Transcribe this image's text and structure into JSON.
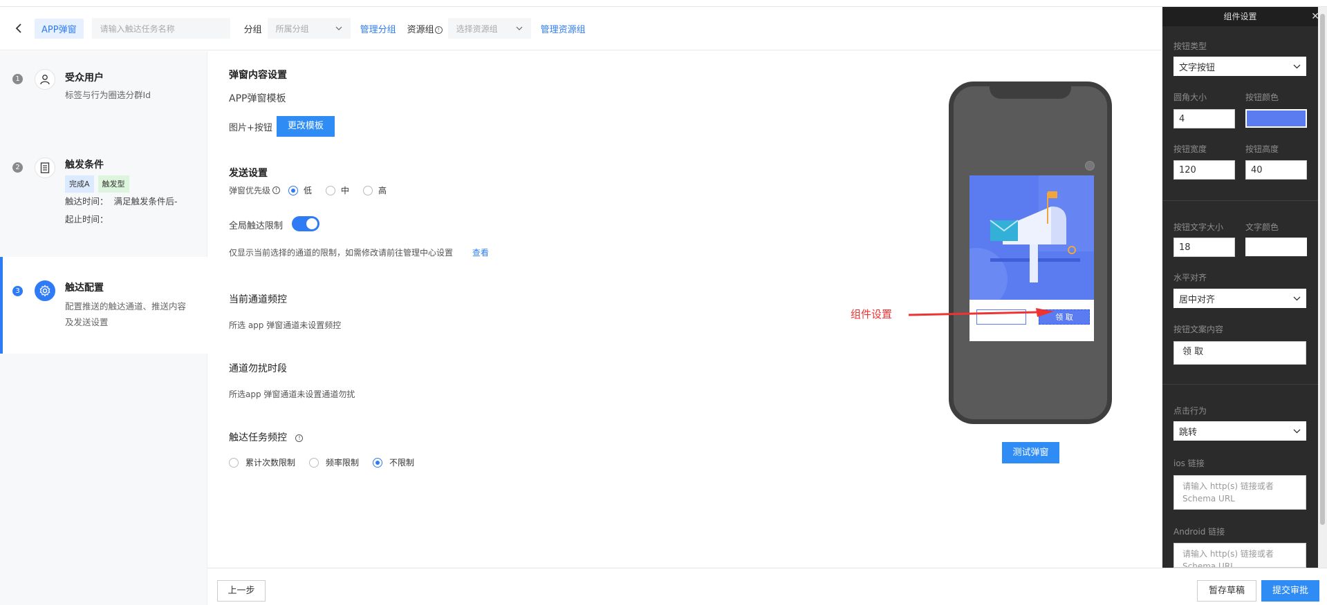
{
  "header": {
    "app_tag": "APP弹窗",
    "task_name_placeholder": "请输入触达任务名称",
    "group_label": "分组",
    "group_select_placeholder": "所属分组",
    "manage_group_link": "管理分组",
    "resource_group_label": "资源组",
    "resource_select_placeholder": "选择资源组",
    "manage_resource_link": "管理资源组"
  },
  "sidebar": {
    "steps": [
      {
        "num": "1",
        "title": "受众用户",
        "desc": "标签与行为圈选分群Id"
      },
      {
        "num": "2",
        "title": "触发条件",
        "badges": [
          "完成A",
          "触发型"
        ],
        "time_label": "触达时间：",
        "time_value": "满足触发条件后-",
        "period_label": "起止时间："
      },
      {
        "num": "3",
        "title": "触达配置",
        "desc_line1": "配置推送的触达通道、推送内容",
        "desc_line2": "及发送设置"
      }
    ]
  },
  "main": {
    "content_title": "弹窗内容设置",
    "template_label": "APP弹窗模板",
    "template_value": "图片+按钮",
    "change_template_btn": "更改模板",
    "send_title": "发送设置",
    "priority_label": "弹窗优先级",
    "priority_options": [
      "低",
      "中",
      "高"
    ],
    "global_limit_label": "全局触达限制",
    "limit_note": "仅显示当前选择的通道的限制，如需修改请前往管理中心设置",
    "view_link": "查看",
    "freq_title": "当前通道频控",
    "freq_desc": "所选 app 弹窗通道未设置频控",
    "dnd_title": "通道勿扰时段",
    "dnd_desc": "所选app 弹窗通道未设置通道勿扰",
    "task_freq_title": "触达任务频控",
    "task_freq_options": [
      "累计次数限制",
      "频率限制",
      "不限制"
    ],
    "annotation": "组件设置",
    "popup_button_text": "领 取",
    "test_btn": "测试弹窗"
  },
  "panel": {
    "title": "组件设置",
    "button_type_label": "按钮类型",
    "button_type_value": "文字按钮",
    "radius_label": "圆角大小",
    "radius_value": "4",
    "color_label": "按钮颜色",
    "width_label": "按钮宽度",
    "width_value": "120",
    "height_label": "按钮高度",
    "height_value": "40",
    "font_size_label": "按钮文字大小",
    "font_size_value": "18",
    "text_color_label": "文字颜色",
    "align_label": "水平对齐",
    "align_value": "居中对齐",
    "text_content_label": "按钮文案内容",
    "text_content_value": "领 取",
    "click_label": "点击行为",
    "click_value": "跳转",
    "ios_label": "ios 链接",
    "ios_placeholder": "请输入 http(s) 链接或者 Schema URL",
    "android_label": "Android 链接",
    "android_placeholder": "请输入 http(s) 链接或者 Schema URL"
  },
  "footer": {
    "prev_btn": "上一步",
    "save_draft_btn": "暂存草稿",
    "submit_btn": "提交审批"
  },
  "colors": {
    "accent": "#2f7bf5",
    "button_color": "#5b7cf0",
    "text_color": "#ffffff"
  }
}
